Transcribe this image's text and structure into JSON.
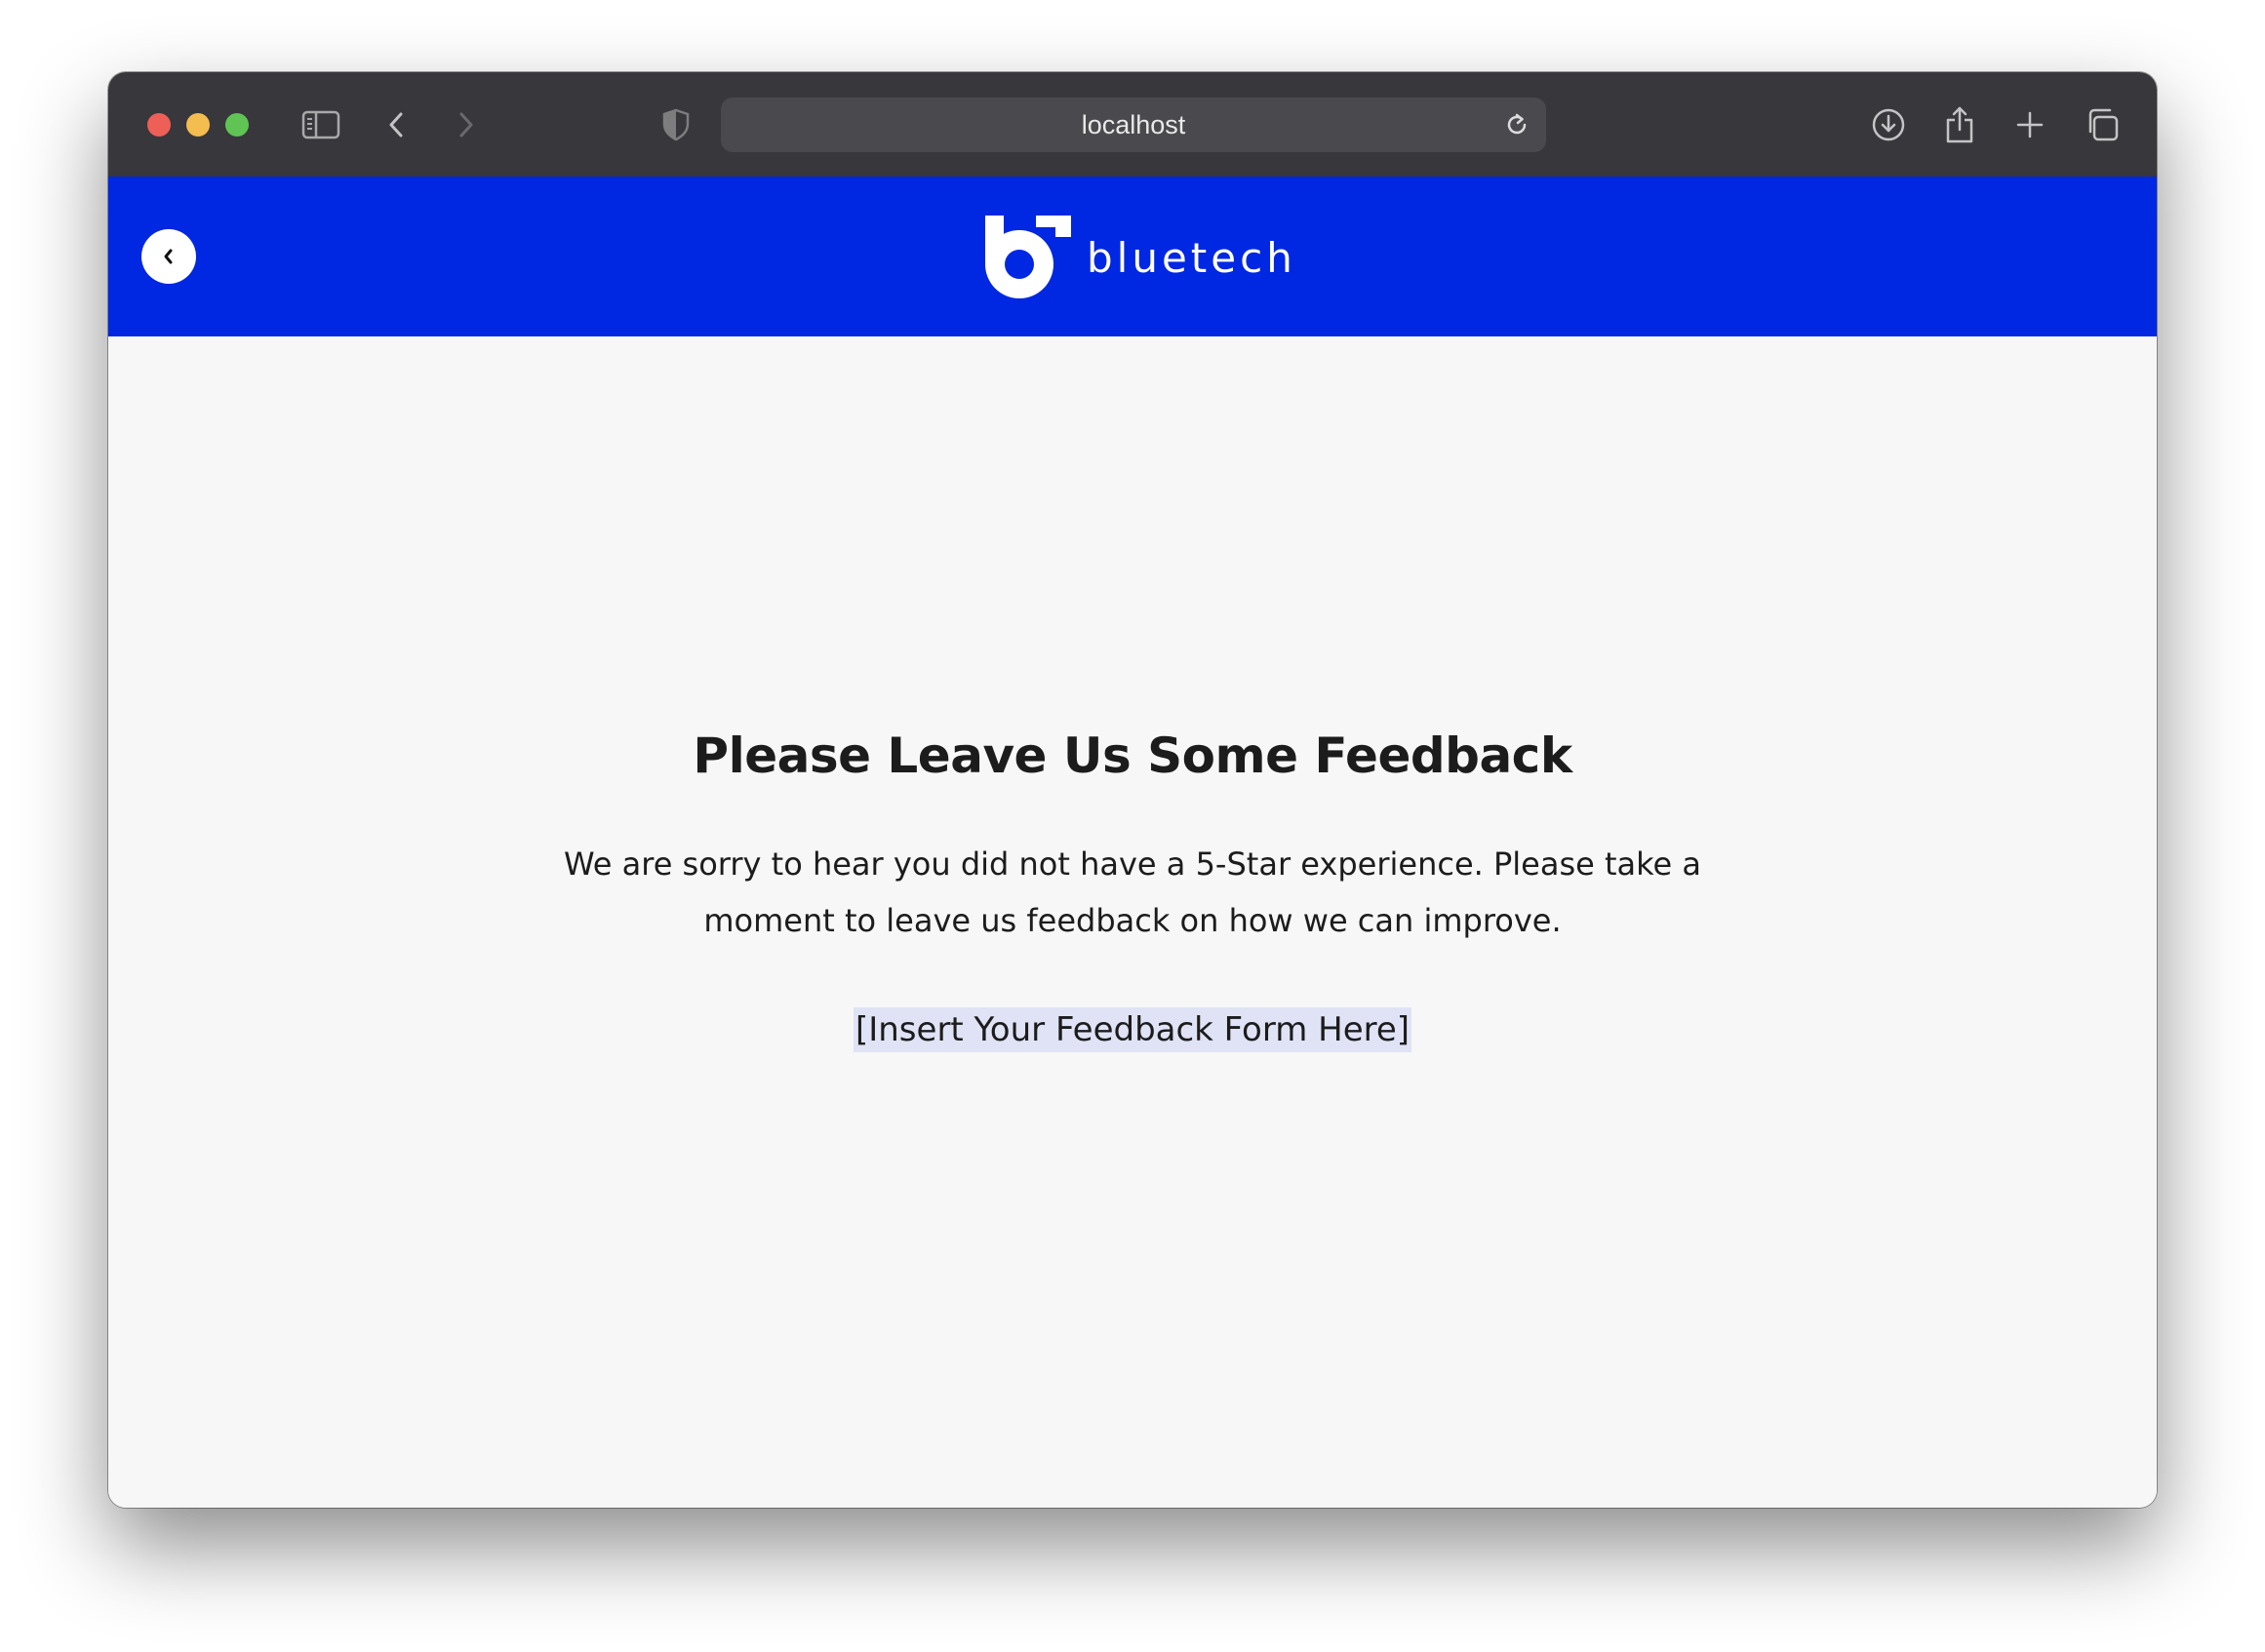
{
  "browser": {
    "url": "localhost",
    "icons": {
      "sidebar": "sidebar-toggle-icon",
      "back": "chevron-left-icon",
      "forward": "chevron-right-icon",
      "privacy": "shield-icon",
      "reload": "reload-icon",
      "downloads": "download-icon",
      "share": "share-icon",
      "new_tab": "plus-icon",
      "tabs": "tab-overview-icon"
    },
    "colors": {
      "toolbar": "#38373b",
      "address_bar": "#4a494d"
    }
  },
  "site": {
    "brand": "bluetech",
    "back_label": "‹",
    "colors": {
      "header": "#0027e2",
      "page_bg": "#f7f7f7",
      "highlight": "#dfe3f5"
    }
  },
  "main": {
    "heading": "Please Leave Us Some Feedback",
    "description": "We are sorry to hear you did not have a 5-Star experience. Please take a moment to leave us feedback on how we can improve.",
    "form_placeholder": "[Insert Your Feedback Form Here]"
  }
}
